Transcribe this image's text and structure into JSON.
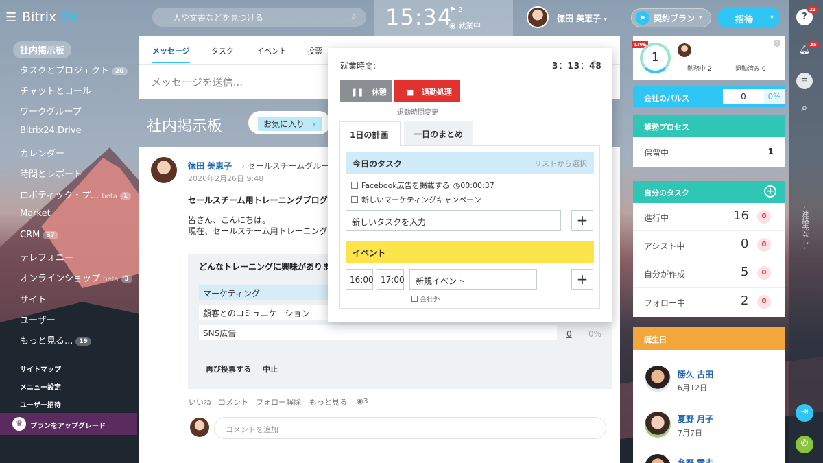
{
  "app": {
    "name": "Bitrix",
    "name_num": "24"
  },
  "search": {
    "placeholder": "人や文書などを見つける"
  },
  "clock": {
    "time": "15:34",
    "flag_count": "2",
    "status": "就業中"
  },
  "user": {
    "name": "徳田 美恵子"
  },
  "header": {
    "plan_label": "契約プラン",
    "invite_label": "招待"
  },
  "sidebar": {
    "items": [
      {
        "label": "社内掲示板",
        "active": true
      },
      {
        "label": "タスクとプロジェクト",
        "count": "20"
      },
      {
        "label": "チャットとコール"
      },
      {
        "label": "ワークグループ"
      },
      {
        "label": "Bitrix24.Drive"
      },
      {
        "label": "カレンダー"
      },
      {
        "label": "時間とレポート"
      },
      {
        "label": "ロボティック・プ...",
        "beta": "beta",
        "count": "1"
      },
      {
        "label": "Market"
      },
      {
        "label": "CRM",
        "count": "37"
      },
      {
        "label": "テレフォニー"
      },
      {
        "label": "オンラインショップ",
        "beta": "beta",
        "count": "3"
      },
      {
        "label": "サイト"
      },
      {
        "label": "ユーザー"
      },
      {
        "label": "もっと見る...",
        "count": "19"
      }
    ],
    "footer": [
      "サイトマップ",
      "メニュー設定",
      "ユーザー招待"
    ],
    "upgrade_label": "プランをアップグレード"
  },
  "feed": {
    "tabs": [
      "メッセージ",
      "タスク",
      "イベント",
      "投票"
    ],
    "message_placeholder": "メッセージを送信...",
    "page_title": "社内掲示板",
    "filter_tag": "お気に入り"
  },
  "post": {
    "author": "徳田 美恵子",
    "destination": "セールスチームグループ",
    "date": "2020年2月26日 9:48",
    "title": "セールスチーム用トレーニングプログラム",
    "body1": "皆さん、こんにちは。",
    "body2": "現在、セールスチーム用トレーニングプログラムを",
    "vote": {
      "question": "どんなトレーニングに興味がありますか",
      "options": [
        "マーケティング",
        "顧客とのコミュニケーション",
        "SNS広告"
      ],
      "sns_count": "0",
      "sns_pct": "0%",
      "revote_label": "再び投票する",
      "stop_label": "中止"
    },
    "actions": {
      "like": "いいね",
      "comment": "コメント",
      "unfollow": "フォロー解除",
      "more": "もっと見る",
      "views": "3"
    },
    "comment_placeholder": "コメントを追加"
  },
  "worktime": {
    "label": "就業時間:",
    "elapsed": "3：13：48",
    "pause_label": "休憩",
    "stop_label": "退勤処理",
    "change_label": "退勤時間変更",
    "tab_plan": "1日の計画",
    "tab_summary": "一日のまとめ",
    "tasks_title": "今日のタスク",
    "tasks_link": "リストから選択",
    "tasks": [
      {
        "label": "Facebook広告を掲載する",
        "time": "00:00:37"
      },
      {
        "label": "新しいマーケティングキャンペーン"
      }
    ],
    "new_task_placeholder": "新しいタスクを入力",
    "events_title": "イベント",
    "event_start": "16:00",
    "event_end": "17:00",
    "event_name_placeholder": "新規イベント",
    "external_label": "会社外"
  },
  "right": {
    "live": "LIVE",
    "online_count": "1",
    "working_label": "勤務中",
    "working_count": "2",
    "done_label": "退勤済み",
    "done_count": "0",
    "pulse_label": "会社のパルス",
    "pulse_value": "0",
    "pulse_pct": "0%",
    "process_label": "業務プロセス",
    "pending_label": "保留中",
    "pending_count": "1",
    "mytasks_label": "自分のタスク",
    "mytasks": [
      {
        "label": "進行中",
        "count": "16",
        "badge": "0"
      },
      {
        "label": "アシスト中",
        "count": "0",
        "badge": "0"
      },
      {
        "label": "自分が作成",
        "count": "5",
        "badge": "0"
      },
      {
        "label": "フォロー中",
        "count": "2",
        "badge": "0"
      }
    ],
    "birthday_label": "誕生日",
    "birthdays": [
      {
        "name": "勝久 古田",
        "date": "6月12日"
      },
      {
        "name": "夏野 月子",
        "date": "7月7日"
      },
      {
        "name": "冬野 雪走",
        "date": ""
      }
    ]
  },
  "rightbar": {
    "help_badge": "23",
    "bell_badge": "35",
    "contacts_label": "- 連絡先なし -"
  },
  "colors": {
    "accent": "#2fc6f6",
    "teal": "#2fc6b6",
    "orange": "#f3a73a",
    "red": "#e2322f",
    "yellow": "#fde44a"
  }
}
